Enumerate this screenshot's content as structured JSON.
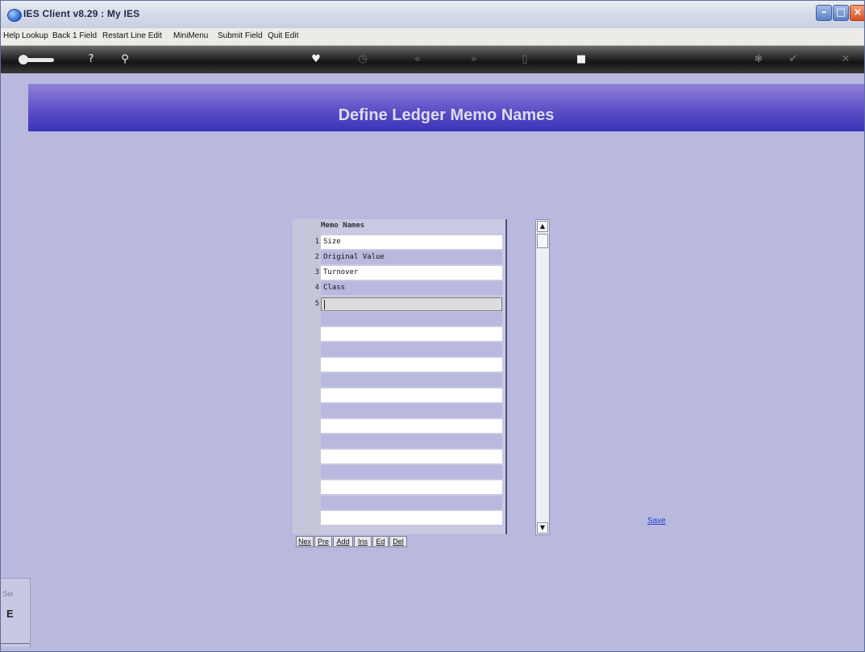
{
  "window": {
    "title": "IES Client v8.29 : My IES"
  },
  "menu": [
    "Help",
    "Lookup",
    "Back 1 Field",
    "Restart Line Edit",
    "MiniMenu",
    "Submit Field",
    "Quit Edit"
  ],
  "page": {
    "title": "Define Ledger Memo Names"
  },
  "grid": {
    "header": "Memo Names",
    "rows": [
      {
        "num": "1",
        "value": "Size"
      },
      {
        "num": "2",
        "value": "Original Value"
      },
      {
        "num": "3",
        "value": "Turnover"
      },
      {
        "num": "4",
        "value": "Class"
      },
      {
        "num": "5",
        "value": ""
      }
    ],
    "buttons": [
      "Nex",
      "Pre",
      "Add",
      "Ins",
      "Ed",
      "Del"
    ]
  },
  "save_link": "Save",
  "side": {
    "label": "Sei",
    "big": "E"
  }
}
